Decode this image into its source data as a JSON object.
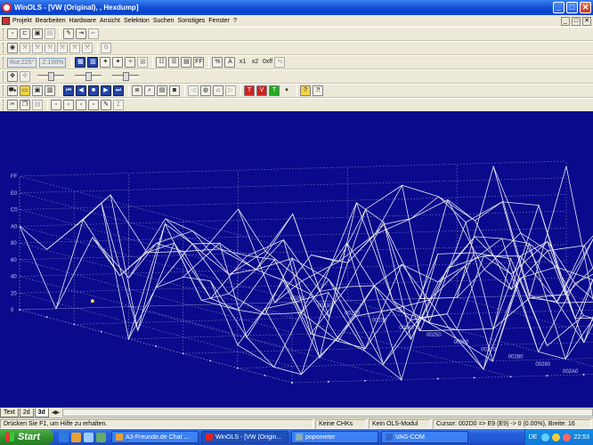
{
  "window": {
    "title": "WinOLS - [VW (Original), , Hexdump]",
    "buttons": {
      "minimize": "_",
      "maximize": "□",
      "close": "✕"
    }
  },
  "menubar": {
    "items": [
      "Projekt",
      "Bearbeiten",
      "Hardware",
      "Ansicht",
      "Selektion",
      "Suchen",
      "Sonstiges",
      "Fenster",
      "?"
    ],
    "mdi_buttons": [
      "_",
      "□",
      "✕"
    ]
  },
  "toolbar": {
    "rot_value": "Rot:225°",
    "zoom_value": "Z:100%",
    "tick_x1": "x1",
    "tick_x2": "x2",
    "ascii_label": "abc",
    "percent_icon": "%",
    "a_icon": "A",
    "ff_icon": "FF",
    "hex_icon": "0xff"
  },
  "view": {
    "background": "#0a0a8c",
    "line_color": "#e8e8f0",
    "y_ticks": [
      "FF",
      "E0",
      "C0",
      "A0",
      "80",
      "60",
      "40",
      "20",
      "0"
    ],
    "row_labels": [
      "00200",
      "00210",
      "00220",
      "00230",
      "00240",
      "00250",
      "00260",
      "00270",
      "00280",
      "00290",
      "002A0"
    ]
  },
  "tabs": [
    "Text",
    "2d",
    "3d"
  ],
  "active_tab": "3d",
  "status": {
    "help": "Drücken Sie F1, um Hilfe zu erhalten.",
    "chk": "Keine CHKs",
    "ols": "Kein OLS-Modul",
    "cursor": "Cursor: 002D0 => E9 (E9) -> 0 (0.00%), Breite: 16"
  },
  "taskbar": {
    "start": "Start",
    "tasks": [
      {
        "label": "A3-Freunde.de Chat ...",
        "color": "#e8a030"
      },
      {
        "label": "WinOLS - [VW (Origin...",
        "color": "#d22"
      },
      {
        "label": "popometer",
        "color": "#8ab"
      },
      {
        "label": "VAG-COM",
        "color": "#36c"
      }
    ],
    "active_task": 1,
    "lang": "DE",
    "clock": "22:53"
  }
}
